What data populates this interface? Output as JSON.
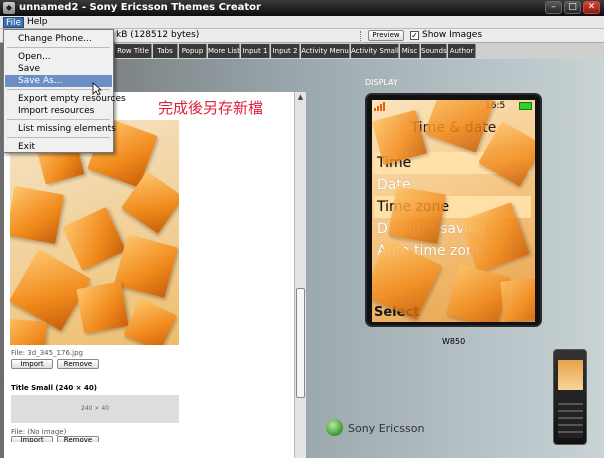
{
  "window": {
    "title": "unnamed2 - Sony Ericsson Themes Creator",
    "icon": "app-icon",
    "controls": [
      "minimize-icon",
      "maximize-icon",
      "close-icon"
    ]
  },
  "menubar": {
    "file": "File",
    "help": "Help"
  },
  "file_menu": {
    "items": [
      {
        "label": "Change Phone..."
      },
      {
        "label": "Open..."
      },
      {
        "label": "Save"
      },
      {
        "label": "Save As...",
        "highlighted": true
      },
      {
        "label": "Export empty resources"
      },
      {
        "label": "Import resources"
      },
      {
        "label": "List missing elements"
      },
      {
        "label": "Exit"
      }
    ]
  },
  "toolbar": {
    "size_text": "kB (128512 bytes)",
    "preview_label": "Preview",
    "show_images_label": "Show Images",
    "show_images_checked": true
  },
  "tabs": [
    "Row Title",
    "Tabs",
    "Popup",
    "More List",
    "Input 1",
    "Input 2",
    "Activity Menu",
    "Activity Small",
    "Misc",
    "Sounds",
    "Author"
  ],
  "left_panel": {
    "annotation": "完成後另存新檔",
    "background_file_label": "File: 3d_345_176.jpg",
    "import_label": "Import",
    "remove_label": "Remove",
    "title_small_label": "Title Small (240 × 40)",
    "title_small_placeholder": "240 × 40",
    "title_small_file": "File: (No image)"
  },
  "display": {
    "label": "DISPLAY",
    "clock": "16:5",
    "screen_title": "Time & date",
    "menu_items": [
      {
        "label": "Time",
        "selected": true
      },
      {
        "label": "Date",
        "selected": false
      },
      {
        "label": "Time zone",
        "selected": true
      },
      {
        "label": "Daylight saving",
        "selected": false
      },
      {
        "label": "Auto time zone",
        "selected": false
      }
    ],
    "softkey": "Select",
    "model": "W850"
  },
  "brand": {
    "name": "Sony Ericsson"
  },
  "colors": {
    "accent": "#3d6fb1",
    "annotation": "#e0203a",
    "selection": "#ffe2aa",
    "cube": "#f08a1c"
  }
}
